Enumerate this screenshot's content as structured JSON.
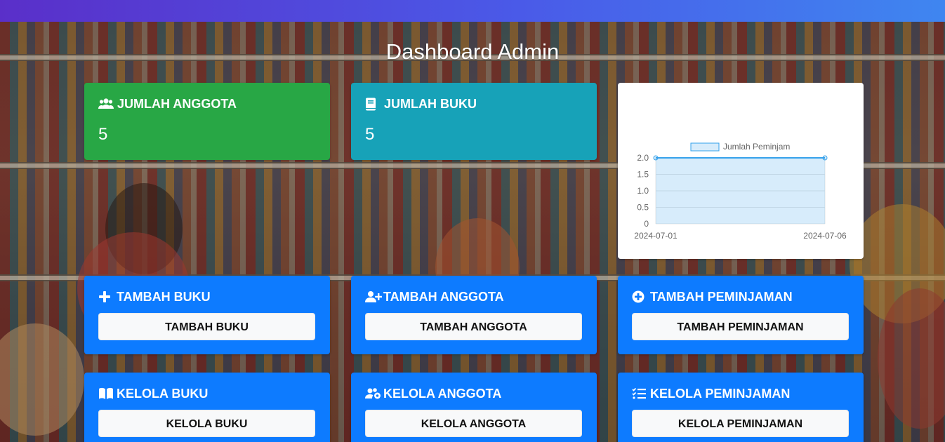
{
  "page": {
    "title": "Dashboard Admin"
  },
  "colors": {
    "green": "#28a745",
    "teal": "#17a2b8",
    "blue": "#0d7bff",
    "button_bg": "#f8f9fa"
  },
  "stats": [
    {
      "label": "JUMLAH ANGGOTA",
      "value": "5",
      "icon": "users-icon"
    },
    {
      "label": "JUMLAH BUKU",
      "value": "5",
      "icon": "book-icon"
    }
  ],
  "chart_data": {
    "type": "line",
    "x": [
      "2024-07-01",
      "2024-07-06"
    ],
    "series": [
      {
        "name": "Jumlah Peminjam",
        "values": [
          2,
          2
        ]
      }
    ],
    "yticks": [
      "0",
      "0.5",
      "1.0",
      "1.5",
      "2.0"
    ],
    "ylim": [
      0,
      2
    ],
    "legend": "top",
    "fill": true
  },
  "actions": [
    {
      "title": "TAMBAH BUKU",
      "button": "TAMBAH BUKU",
      "icon": "plus-icon"
    },
    {
      "title": "TAMBAH ANGGOTA",
      "button": "TAMBAH ANGGOTA",
      "icon": "user-plus-icon"
    },
    {
      "title": "TAMBAH PEMINJAMAN",
      "button": "TAMBAH PEMINJAMAN",
      "icon": "plus-circle-icon"
    },
    {
      "title": "KELOLA BUKU",
      "button": "KELOLA BUKU",
      "icon": "book-open-icon"
    },
    {
      "title": "KELOLA ANGGOTA",
      "button": "KELOLA ANGGOTA",
      "icon": "users-cog-icon"
    },
    {
      "title": "KELOLA PEMINJAMAN",
      "button": "KELOLA PEMINJAMAN",
      "icon": "tasks-icon"
    }
  ]
}
